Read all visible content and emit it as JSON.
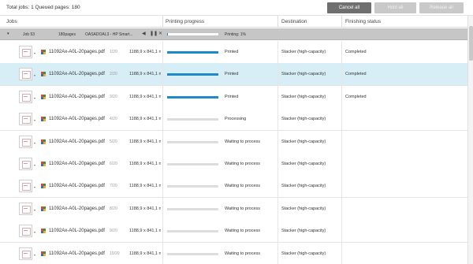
{
  "toolbar": {
    "summary": "Total jobs: 1 Queued pages: 180",
    "cancel_all": "Cancel all",
    "hold_all": "Hold all",
    "release_all": "Release all"
  },
  "columns": {
    "jobs": "Jobs",
    "printing_progress": "Printing progress",
    "destination": "Destination",
    "finishing_status": "Finishing status"
  },
  "job": {
    "chevron": "▾",
    "id": "Job 53",
    "pages": "180pages",
    "printer": "OASADOAL3 - HP Smart...",
    "status": "Printing: 1%",
    "progress": 0.01
  },
  "colors": {
    "accent": "#1e88c8",
    "selected_row": "#d7eef6",
    "job_row": "#c6c6c6",
    "button_active": "#6f6f6f",
    "button_disabled": "#c9c9c9"
  },
  "files": [
    {
      "name": "11092Ax-A0L-20pages.pdf",
      "pages": "1/20",
      "size": "1188,9 x 841,1 n",
      "progress": 1.0,
      "status": "Printed",
      "destination": "Stacker (high-capacity)",
      "finishing": "Completed",
      "selected": false
    },
    {
      "name": "11092Ax-A0L-20pages.pdf",
      "pages": "2/20",
      "size": "1188,9 x 841,1 n",
      "progress": 1.0,
      "status": "Printed",
      "destination": "Stacker (high-capacity)",
      "finishing": "Completed",
      "selected": true
    },
    {
      "name": "11092Ax-A0L-20pages.pdf",
      "pages": "3/20",
      "size": "1188,9 x 841,1 n",
      "progress": 1.0,
      "status": "Printed",
      "destination": "Stacker (high-capacity)",
      "finishing": "Completed",
      "selected": false
    },
    {
      "name": "11092Ax-A0L-20pages.pdf",
      "pages": "4/20",
      "size": "1188,9 x 841,1 n",
      "progress": 0.0,
      "status": "Processing",
      "destination": "Stacker (high-capacity)",
      "finishing": "",
      "selected": false
    },
    {
      "name": "11092Ax-A0L-20pages.pdf",
      "pages": "5/20",
      "size": "1188,9 x 841,1 n",
      "progress": 0.0,
      "status": "Waiting to process",
      "destination": "Stacker (high-capacity)",
      "finishing": "",
      "selected": false
    },
    {
      "name": "11092Ax-A0L-20pages.pdf",
      "pages": "6/20",
      "size": "1188,9 x 841,1 n",
      "progress": 0.0,
      "status": "Waiting to process",
      "destination": "Stacker (high-capacity)",
      "finishing": "",
      "selected": false
    },
    {
      "name": "11092Ax-A0L-20pages.pdf",
      "pages": "7/20",
      "size": "1188,9 x 841,1 n",
      "progress": 0.0,
      "status": "Waiting to process",
      "destination": "Stacker (high-capacity)",
      "finishing": "",
      "selected": false
    },
    {
      "name": "11092Ax-A0L-20pages.pdf",
      "pages": "8/20",
      "size": "1188,9 x 841,1 n",
      "progress": 0.0,
      "status": "Waiting to process",
      "destination": "Stacker (high-capacity)",
      "finishing": "",
      "selected": false
    },
    {
      "name": "11092Ax-A0L-20pages.pdf",
      "pages": "9/20",
      "size": "1188,9 x 841,1 n",
      "progress": 0.0,
      "status": "Waiting to process",
      "destination": "Stacker (high-capacity)",
      "finishing": "",
      "selected": false
    },
    {
      "name": "11092Ax-A0L-20pages.pdf",
      "pages": "10/20",
      "size": "1188,9 x 841,1 n",
      "progress": 0.0,
      "status": "Waiting to process",
      "destination": "Stacker (high-capacity)",
      "finishing": "",
      "selected": false
    }
  ]
}
